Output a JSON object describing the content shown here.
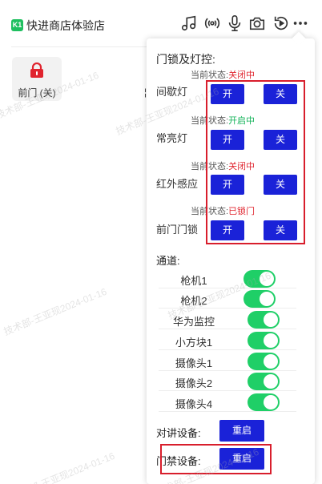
{
  "shop": {
    "badge": "K1",
    "name": "快进商店体验店"
  },
  "header_icons": [
    "music-icon",
    "broadcast-icon",
    "microphone-icon",
    "camera-icon",
    "replay-icon",
    "more-icon"
  ],
  "device": {
    "label": "前门 (关)",
    "partial_label": "¦"
  },
  "popup": {
    "title": "门锁及灯控:",
    "controls": [
      {
        "name": "间歇灯",
        "status_prefix": "当前状态:",
        "status": "关闭中",
        "status_type": "off",
        "on_label": "开",
        "off_label": "关"
      },
      {
        "name": "常亮灯",
        "status_prefix": "当前状态:",
        "status": "开启中",
        "status_type": "on",
        "on_label": "开",
        "off_label": "关"
      },
      {
        "name": "红外感应",
        "status_prefix": "当前状态:",
        "status": "关闭中",
        "status_type": "off",
        "on_label": "开",
        "off_label": "关"
      },
      {
        "name": "前门门锁",
        "status_prefix": "当前状态:",
        "status": "已锁门",
        "status_type": "off",
        "on_label": "开",
        "off_label": "关"
      }
    ],
    "channels_title": "通道:",
    "channels": [
      {
        "name": "枪机1",
        "enabled": true
      },
      {
        "name": "枪机2",
        "enabled": true
      },
      {
        "name": "华为监控",
        "enabled": true
      },
      {
        "name": "小方块1",
        "enabled": true
      },
      {
        "name": "摄像头1",
        "enabled": true
      },
      {
        "name": "摄像头2",
        "enabled": true
      },
      {
        "name": "摄像头4",
        "enabled": true
      }
    ],
    "intercom": {
      "label": "对讲设备:",
      "button": "重启"
    },
    "access": {
      "label": "门禁设备:",
      "button": "重启"
    }
  },
  "watermark": "技术部-王亚现2024-01-16",
  "colors": {
    "primary_button": "#1a22d8",
    "toggle_on": "#1fcf67",
    "status_off": "#e0242e",
    "status_on": "#14b35a",
    "highlight": "#d81e2c"
  }
}
